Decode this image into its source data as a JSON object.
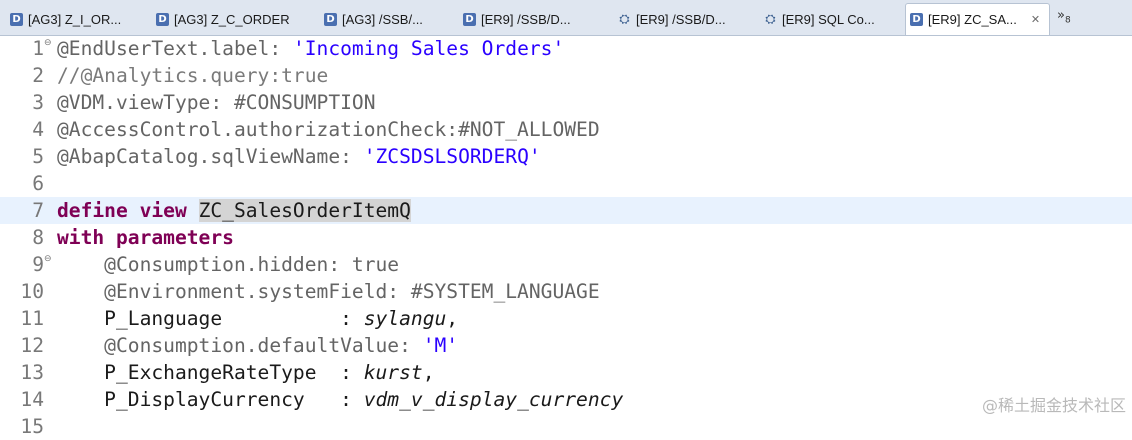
{
  "tabs": [
    {
      "label": "[AG3] Z_I_OR...",
      "icon": "ddl-source-icon",
      "active": false
    },
    {
      "label": "[AG3] Z_C_ORDER",
      "icon": "ddl-source-icon",
      "active": false
    },
    {
      "label": "[AG3] /SSB/...",
      "icon": "ddl-source-icon",
      "active": false
    },
    {
      "label": "[ER9] /SSB/D...",
      "icon": "ddl-source-icon",
      "active": false
    },
    {
      "label": "[ER9] /SSB/D...",
      "icon": "sql-console-icon",
      "active": false
    },
    {
      "label": "[ER9] SQL Co...",
      "icon": "sql-console-icon",
      "active": false
    },
    {
      "label": "[ER9] ZC_SA...",
      "icon": "ddl-source-icon",
      "active": true
    }
  ],
  "tab_close_symbol": "✕",
  "tab_overflow": {
    "symbol": "»",
    "count": "8"
  },
  "editor": {
    "current_line": 7,
    "lines": [
      {
        "num": "1",
        "fold": true,
        "parts": [
          {
            "t": "@EndUserText.label: ",
            "c": "anno"
          },
          {
            "t": "'Incoming Sales Orders'",
            "c": "str"
          }
        ]
      },
      {
        "num": "2",
        "fold": false,
        "parts": [
          {
            "t": "//@Analytics.query:true",
            "c": "cmt"
          }
        ]
      },
      {
        "num": "3",
        "fold": false,
        "parts": [
          {
            "t": "@VDM.viewType: #CONSUMPTION",
            "c": "anno"
          }
        ]
      },
      {
        "num": "4",
        "fold": false,
        "parts": [
          {
            "t": "@AccessControl.authorizationCheck:#NOT_ALLOWED",
            "c": "anno"
          }
        ]
      },
      {
        "num": "5",
        "fold": false,
        "parts": [
          {
            "t": "@AbapCatalog.sqlViewName: ",
            "c": "anno"
          },
          {
            "t": "'ZCSDSLSORDERQ'",
            "c": "str"
          }
        ]
      },
      {
        "num": "6",
        "fold": false,
        "parts": []
      },
      {
        "num": "7",
        "fold": false,
        "parts": [
          {
            "t": "define view ",
            "c": "kw"
          },
          {
            "t": "ZC_SalesOrderItemQ",
            "c": "plain sel"
          }
        ]
      },
      {
        "num": "8",
        "fold": false,
        "parts": [
          {
            "t": "with parameters",
            "c": "kw"
          }
        ]
      },
      {
        "num": "9",
        "fold": true,
        "parts": [
          {
            "t": "    @Consumption.hidden: true",
            "c": "anno"
          }
        ]
      },
      {
        "num": "10",
        "fold": false,
        "parts": [
          {
            "t": "    @Environment.systemField: #SYSTEM_LANGUAGE",
            "c": "anno"
          }
        ]
      },
      {
        "num": "11",
        "fold": false,
        "parts": [
          {
            "t": "    P_Language          : ",
            "c": "plain"
          },
          {
            "t": "sylangu",
            "c": "plain ital"
          },
          {
            "t": ",",
            "c": "plain"
          }
        ]
      },
      {
        "num": "12",
        "fold": false,
        "parts": [
          {
            "t": "    @Consumption.defaultValue: ",
            "c": "anno"
          },
          {
            "t": "'M'",
            "c": "str"
          }
        ]
      },
      {
        "num": "13",
        "fold": false,
        "parts": [
          {
            "t": "    P_ExchangeRateType  : ",
            "c": "plain"
          },
          {
            "t": "kurst",
            "c": "plain ital"
          },
          {
            "t": ",",
            "c": "plain"
          }
        ]
      },
      {
        "num": "14",
        "fold": false,
        "parts": [
          {
            "t": "    P_DisplayCurrency   : ",
            "c": "plain"
          },
          {
            "t": "vdm_v_display_currency",
            "c": "plain ital"
          }
        ]
      },
      {
        "num": "15",
        "fold": false,
        "parts": []
      }
    ]
  },
  "watermark": "@稀土掘金技术社区"
}
